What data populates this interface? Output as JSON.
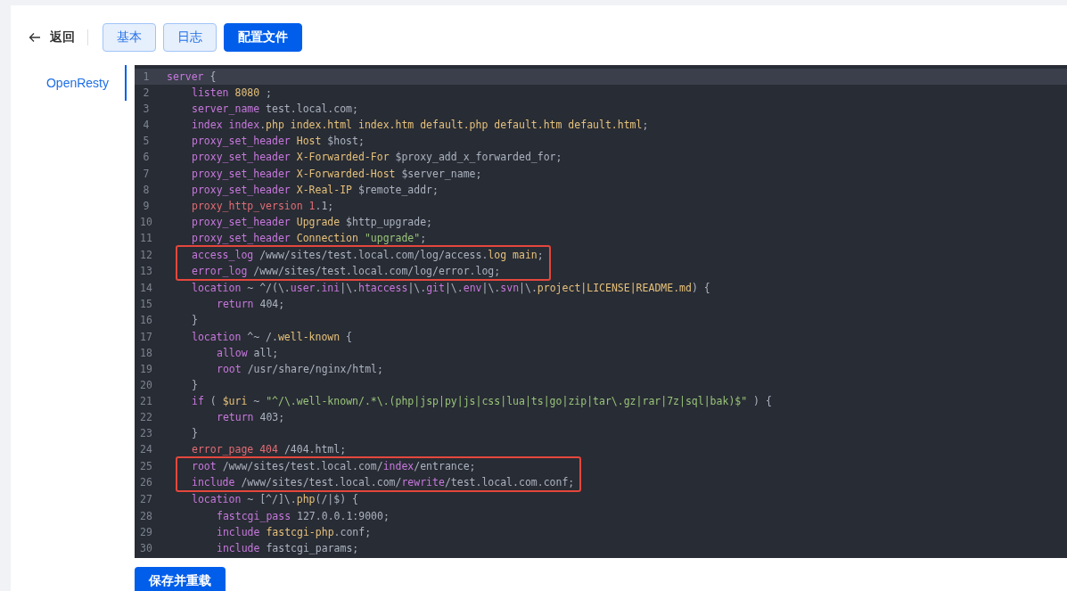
{
  "header": {
    "back": {
      "label": "返回"
    },
    "tabs": [
      {
        "label": "基本",
        "selected": false
      },
      {
        "label": "日志",
        "selected": false
      },
      {
        "label": "配置文件",
        "selected": true
      }
    ]
  },
  "sidebar": {
    "items": [
      {
        "label": "OpenResty",
        "selected": true
      }
    ]
  },
  "editor": {
    "lines": [
      {
        "number": "1",
        "active": true,
        "boxed": false,
        "tokens": [
          {
            "text": "server",
            "kind": "kw"
          },
          {
            "text": " {",
            "kind": "plain"
          }
        ],
        "children": [
          {
            "number": "2",
            "active": false,
            "boxed": false,
            "tokens": [
              {
                "text": "listen",
                "kind": "kw"
              },
              {
                "text": " 8080",
                "kind": "val"
              },
              {
                "text": " ;",
                "kind": "plain"
              }
            ]
          },
          {
            "number": "3",
            "active": false,
            "boxed": false,
            "tokens": [
              {
                "text": "server_name",
                "kind": "kw"
              },
              {
                "text": " test.local.com;",
                "kind": "plain"
              }
            ]
          },
          {
            "number": "4",
            "active": false,
            "boxed": false,
            "tokens": [
              {
                "text": "index",
                "kind": "kw"
              },
              {
                "text": " index",
                "kind": "kw"
              },
              {
                "text": ".",
                "kind": "plain"
              },
              {
                "text": "php index.html index.htm default.php default.htm default.html",
                "kind": "val"
              },
              {
                "text": ";",
                "kind": "plain"
              }
            ]
          },
          {
            "number": "5",
            "active": false,
            "boxed": false,
            "tokens": [
              {
                "text": "proxy_set_header",
                "kind": "kw"
              },
              {
                "text": " Host",
                "kind": "val"
              },
              {
                "text": " $host;",
                "kind": "plain"
              }
            ]
          },
          {
            "number": "6",
            "active": false,
            "boxed": false,
            "tokens": [
              {
                "text": "proxy_set_header",
                "kind": "kw"
              },
              {
                "text": " X-Forwarded-For",
                "kind": "val"
              },
              {
                "text": " $proxy_add_x_forwarded_for;",
                "kind": "plain"
              }
            ]
          },
          {
            "number": "7",
            "active": false,
            "boxed": false,
            "tokens": [
              {
                "text": "proxy_set_header",
                "kind": "kw"
              },
              {
                "text": " X-Forwarded-Host",
                "kind": "val"
              },
              {
                "text": " $server_name;",
                "kind": "plain"
              }
            ]
          },
          {
            "number": "8",
            "active": false,
            "boxed": false,
            "tokens": [
              {
                "text": "proxy_set_header",
                "kind": "kw"
              },
              {
                "text": " X-Real-IP",
                "kind": "val"
              },
              {
                "text": " $remote_addr;",
                "kind": "plain"
              }
            ]
          },
          {
            "number": "9",
            "active": false,
            "boxed": false,
            "tokens": [
              {
                "text": "proxy_http_version",
                "kind": "err"
              },
              {
                "text": " 1",
                "kind": "err"
              },
              {
                "text": ".1;",
                "kind": "plain"
              }
            ]
          },
          {
            "number": "10",
            "active": false,
            "boxed": false,
            "tokens": [
              {
                "text": "proxy_set_header",
                "kind": "kw"
              },
              {
                "text": " Upgrade",
                "kind": "val"
              },
              {
                "text": " $http_upgrade;",
                "kind": "plain"
              }
            ]
          },
          {
            "number": "11",
            "active": false,
            "boxed": false,
            "tokens": [
              {
                "text": "proxy_set_header",
                "kind": "kw"
              },
              {
                "text": " Connection",
                "kind": "val"
              },
              {
                "text": " \"upgrade\"",
                "kind": "str"
              },
              {
                "text": ";",
                "kind": "plain"
              }
            ]
          },
          {
            "number": "12",
            "active": false,
            "boxed": true,
            "tokens": [
              {
                "text": "access_log",
                "kind": "kw"
              },
              {
                "text": " /www/sites/test.local.com/log/access.",
                "kind": "plain"
              },
              {
                "text": "log main",
                "kind": "val"
              },
              {
                "text": ";",
                "kind": "plain"
              }
            ]
          },
          {
            "number": "13",
            "active": false,
            "boxed": true,
            "tokens": [
              {
                "text": "error_log",
                "kind": "kw"
              },
              {
                "text": " /www/sites/test.local.com/log/error.log;",
                "kind": "plain"
              }
            ]
          },
          {
            "number": "14",
            "active": false,
            "boxed": false,
            "tokens": [
              {
                "text": "location",
                "kind": "kw"
              },
              {
                "text": " ~ ^/(\\.",
                "kind": "plain"
              },
              {
                "text": "user",
                "kind": "kw"
              },
              {
                "text": ".",
                "kind": "plain"
              },
              {
                "text": "ini",
                "kind": "kw"
              },
              {
                "text": "|\\.",
                "kind": "plain"
              },
              {
                "text": "htaccess",
                "kind": "kw"
              },
              {
                "text": "|\\.",
                "kind": "plain"
              },
              {
                "text": "git",
                "kind": "kw"
              },
              {
                "text": "|\\.",
                "kind": "plain"
              },
              {
                "text": "env",
                "kind": "kw"
              },
              {
                "text": "|\\.",
                "kind": "plain"
              },
              {
                "text": "svn",
                "kind": "kw"
              },
              {
                "text": "|\\.",
                "kind": "plain"
              },
              {
                "text": "project|LICENSE|README.md",
                "kind": "val"
              },
              {
                "text": ") {",
                "kind": "plain"
              }
            ],
            "children": [
              {
                "number": "15",
                "active": false,
                "boxed": false,
                "tokens": [
                  {
                    "text": "return",
                    "kind": "kw"
                  },
                  {
                    "text": " 404;",
                    "kind": "plain"
                  }
                ]
              }
            ]
          },
          {
            "number": "16",
            "active": false,
            "boxed": false,
            "tokens": [
              {
                "text": "}",
                "kind": "plain"
              }
            ]
          },
          {
            "number": "17",
            "active": false,
            "boxed": false,
            "tokens": [
              {
                "text": "location",
                "kind": "kw"
              },
              {
                "text": " ^~ /.",
                "kind": "plain"
              },
              {
                "text": "well-known",
                "kind": "val"
              },
              {
                "text": " {",
                "kind": "plain"
              }
            ],
            "children": [
              {
                "number": "18",
                "active": false,
                "boxed": false,
                "tokens": [
                  {
                    "text": "allow",
                    "kind": "kw"
                  },
                  {
                    "text": " all;",
                    "kind": "plain"
                  }
                ]
              },
              {
                "number": "19",
                "active": false,
                "boxed": false,
                "tokens": [
                  {
                    "text": "root",
                    "kind": "kw"
                  },
                  {
                    "text": " /usr/share/nginx/html;",
                    "kind": "plain"
                  }
                ]
              }
            ]
          },
          {
            "number": "20",
            "active": false,
            "boxed": false,
            "tokens": [
              {
                "text": "}",
                "kind": "plain"
              }
            ]
          },
          {
            "number": "21",
            "active": false,
            "boxed": false,
            "tokens": [
              {
                "text": "if",
                "kind": "kw"
              },
              {
                "text": " ( ",
                "kind": "plain"
              },
              {
                "text": "$uri",
                "kind": "val"
              },
              {
                "text": " ~ ",
                "kind": "plain"
              },
              {
                "text": "\"^/\\.well-known/.*\\.(php|jsp|py|js|css|lua|ts|go|zip|tar\\.gz|rar|7z|sql|bak)$\"",
                "kind": "str"
              },
              {
                "text": " ) {",
                "kind": "plain"
              }
            ],
            "children": [
              {
                "number": "22",
                "active": false,
                "boxed": false,
                "tokens": [
                  {
                    "text": "return",
                    "kind": "kw"
                  },
                  {
                    "text": " 403;",
                    "kind": "plain"
                  }
                ]
              }
            ]
          },
          {
            "number": "23",
            "active": false,
            "boxed": false,
            "tokens": [
              {
                "text": "}",
                "kind": "plain"
              }
            ]
          },
          {
            "number": "24",
            "active": false,
            "boxed": false,
            "tokens": [
              {
                "text": "error_page",
                "kind": "err"
              },
              {
                "text": " 404",
                "kind": "err"
              },
              {
                "text": " /404.html;",
                "kind": "plain"
              }
            ]
          },
          {
            "number": "25",
            "active": false,
            "boxed": true,
            "tokens": [
              {
                "text": "root",
                "kind": "kw"
              },
              {
                "text": " /www/sites/test.local.com/",
                "kind": "plain"
              },
              {
                "text": "index",
                "kind": "kw"
              },
              {
                "text": "/entrance;",
                "kind": "plain"
              }
            ]
          },
          {
            "number": "26",
            "active": false,
            "boxed": true,
            "tokens": [
              {
                "text": "include",
                "kind": "kw"
              },
              {
                "text": " /www/sites/test.local.com/",
                "kind": "plain"
              },
              {
                "text": "rewrite",
                "kind": "kw"
              },
              {
                "text": "/test.local.com.conf;",
                "kind": "plain"
              }
            ]
          },
          {
            "number": "27",
            "active": false,
            "boxed": false,
            "tokens": [
              {
                "text": "location",
                "kind": "kw"
              },
              {
                "text": " ~ [^/]\\.",
                "kind": "plain"
              },
              {
                "text": "php",
                "kind": "val"
              },
              {
                "text": "(/|$) {",
                "kind": "plain"
              }
            ],
            "children": [
              {
                "number": "28",
                "active": false,
                "boxed": false,
                "tokens": [
                  {
                    "text": "fastcgi_pass",
                    "kind": "kw"
                  },
                  {
                    "text": " 127.0.0.1:9000;",
                    "kind": "plain"
                  }
                ]
              },
              {
                "number": "29",
                "active": false,
                "boxed": false,
                "tokens": [
                  {
                    "text": "include",
                    "kind": "kw"
                  },
                  {
                    "text": " fastcgi-php",
                    "kind": "val"
                  },
                  {
                    "text": ".conf;",
                    "kind": "plain"
                  }
                ]
              },
              {
                "number": "30",
                "active": false,
                "boxed": false,
                "tokens": [
                  {
                    "text": "include",
                    "kind": "kw"
                  },
                  {
                    "text": " fastcgi_params;",
                    "kind": "plain"
                  }
                ]
              }
            ]
          }
        ]
      }
    ]
  },
  "footer": {
    "button": "保存并重载"
  }
}
